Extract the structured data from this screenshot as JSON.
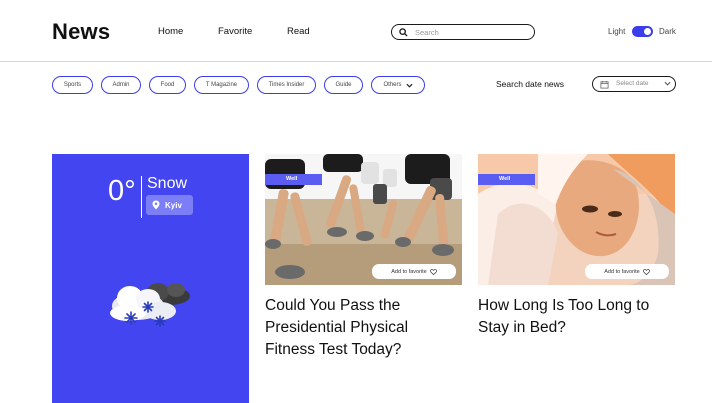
{
  "header": {
    "logo": "News",
    "nav": [
      "Home",
      "Favorite",
      "Read"
    ],
    "search_placeholder": "Search",
    "theme_light": "Light",
    "theme_dark": "Dark"
  },
  "filters": {
    "chips": [
      "Sports",
      "Admin",
      "Food",
      "T Magazine",
      "Times Insider",
      "Guide"
    ],
    "others": "Others",
    "date_label": "Search date news",
    "date_placeholder": "Select date"
  },
  "weather": {
    "temperature": "0°",
    "condition": "Snow",
    "city": "Kyiv"
  },
  "cards": [
    {
      "tag": "Well",
      "favorite": "Add to favorite",
      "title": "Could You Pass the Presidential Physical Fitness Test Today?"
    },
    {
      "tag": "Well",
      "favorite": "Add to favorite",
      "title": "How Long Is Too Long to Stay in Bed?"
    }
  ],
  "colors": {
    "accent": "#3b3dea",
    "weather_bg": "#4245f0",
    "tag_bg": "#5b5df2"
  }
}
